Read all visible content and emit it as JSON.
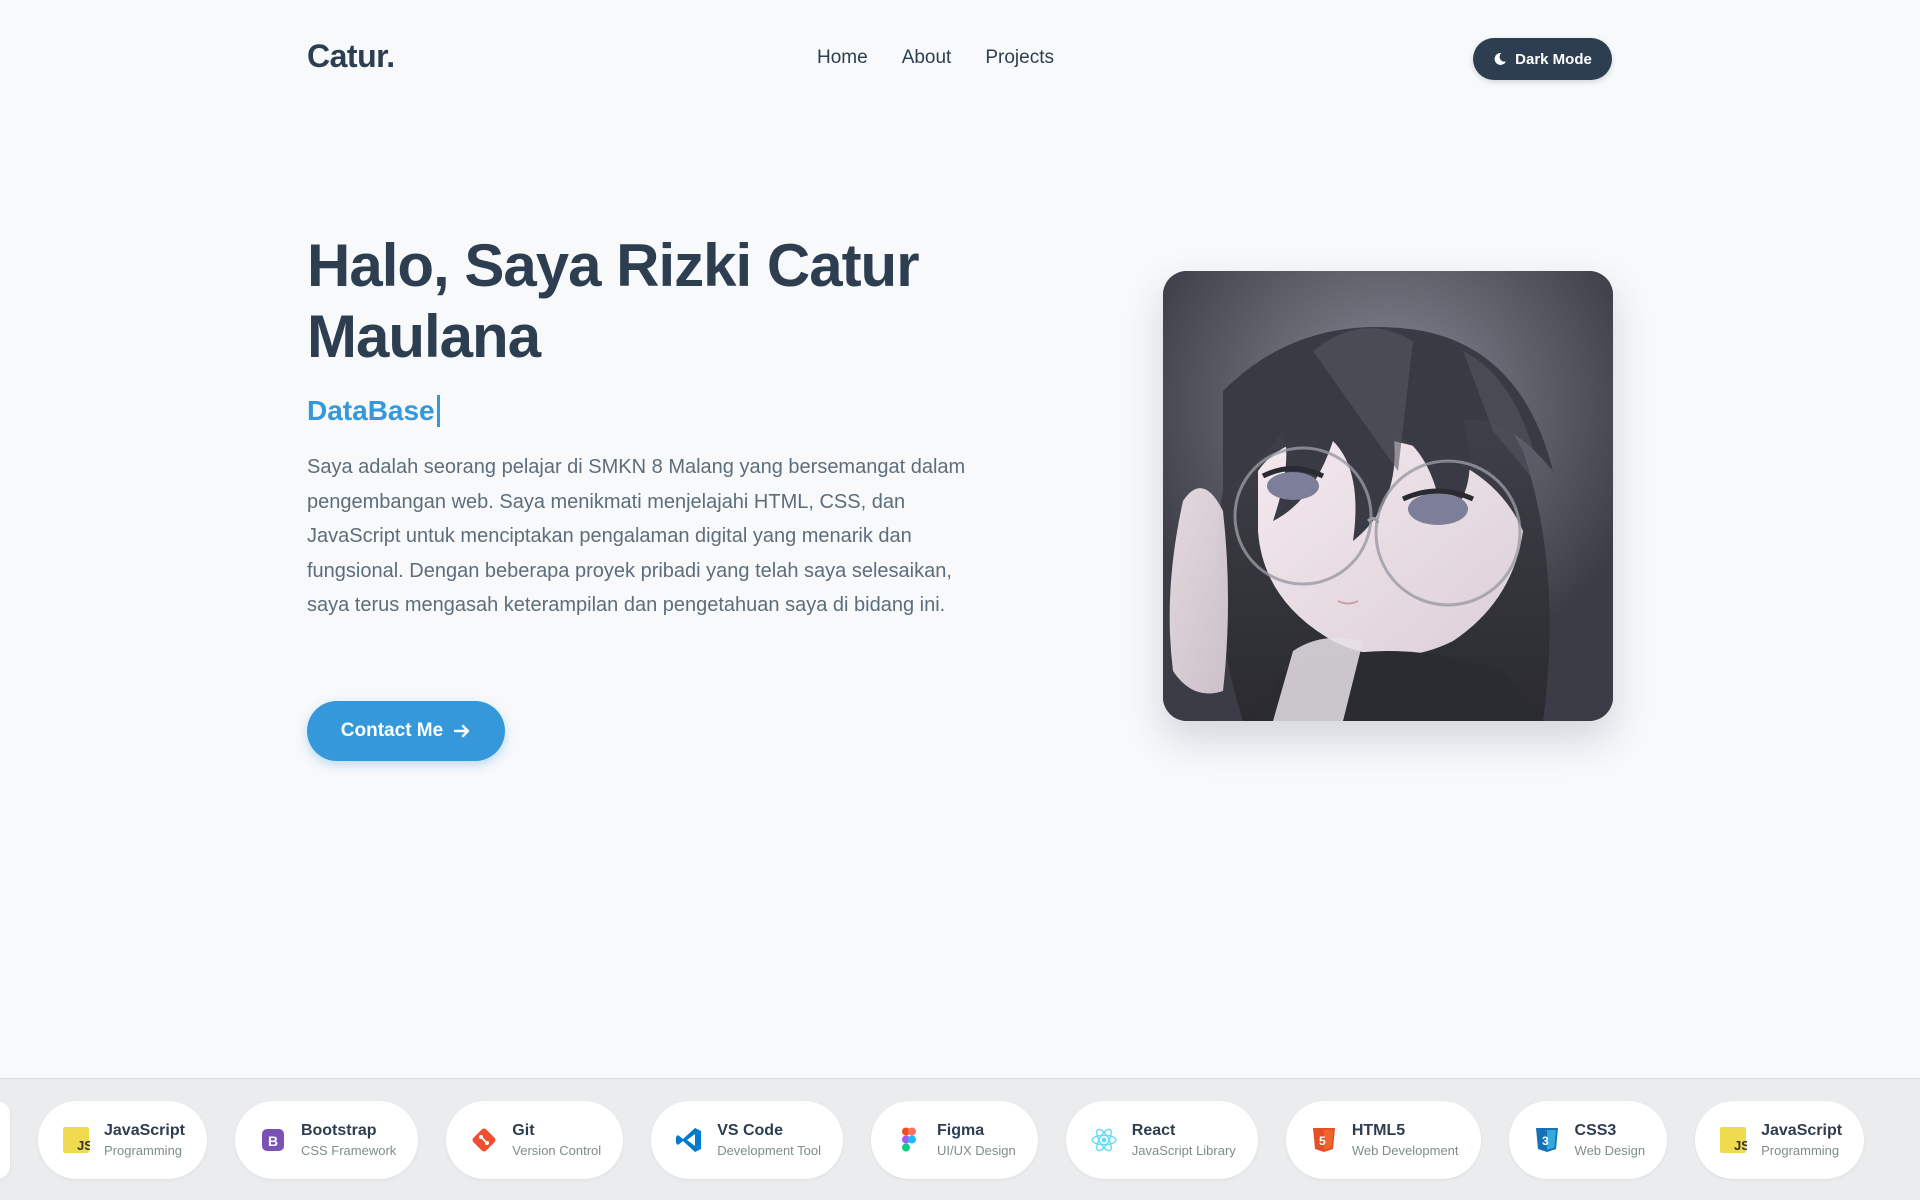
{
  "nav": {
    "logo": "Catur.",
    "links": [
      "Home",
      "About",
      "Projects"
    ],
    "dark_mode_label": "Dark Mode"
  },
  "hero": {
    "title": "Halo, Saya Rizki Catur Maulana",
    "typed_text": "DataBase",
    "description": "Saya adalah seorang pelajar di SMKN 8 Malang yang bersemangat dalam pengembangan web. Saya menikmati menjelajahi HTML, CSS, dan JavaScript untuk menciptakan pengalaman digital yang menarik dan fungsional. Dengan beberapa proyek pribadi yang telah saya selesaikan, saya terus mengasah keterampilan dan pengetahuan saya di bidang ini.",
    "contact_label": "Contact Me"
  },
  "skills": [
    {
      "name": "JavaScript",
      "category": "Programming",
      "icon": "javascript-icon",
      "color": "#f0db4f"
    },
    {
      "name": "Bootstrap",
      "category": "CSS Framework",
      "icon": "bootstrap-icon",
      "color": "#7952b3"
    },
    {
      "name": "Git",
      "category": "Version Control",
      "icon": "git-icon",
      "color": "#f05032"
    },
    {
      "name": "VS Code",
      "category": "Development Tool",
      "icon": "vscode-icon",
      "color": "#007acc"
    },
    {
      "name": "Figma",
      "category": "UI/UX Design",
      "icon": "figma-icon",
      "color": "#a259ff"
    },
    {
      "name": "React",
      "category": "JavaScript Library",
      "icon": "react-icon",
      "color": "#61dafb"
    },
    {
      "name": "HTML5",
      "category": "Web Development",
      "icon": "html5-icon",
      "color": "#e34f26"
    },
    {
      "name": "CSS3",
      "category": "Web Design",
      "icon": "css3-icon",
      "color": "#1572b6"
    },
    {
      "name": "JavaScript",
      "category": "Programming",
      "icon": "javascript-icon",
      "color": "#f0db4f"
    }
  ],
  "colors": {
    "accent": "#3498db",
    "dark": "#2c3e50",
    "background": "#f7f9fb"
  }
}
